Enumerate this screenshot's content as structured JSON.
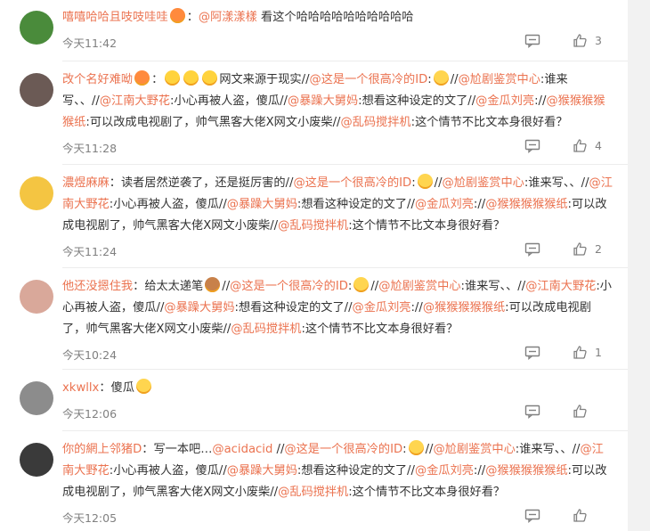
{
  "comments": [
    {
      "name": "嘻嘻哈哈且吱吱哇哇",
      "emoji_after_name": "hot",
      "sep": "：",
      "parts": [
        {
          "t": "mention",
          "v": "@阿漾漾樣"
        },
        {
          "t": "text",
          "v": " 看这个哈哈哈哈哈哈哈哈哈哈"
        }
      ],
      "time": "今天11:42",
      "likes": "3",
      "avatar_color": "#4a8b3b"
    },
    {
      "name": "改个名好难呦",
      "emoji_after_name": "hot",
      "sep": "：",
      "parts": [
        {
          "t": "emoji",
          "v": "laugh"
        },
        {
          "t": "emoji",
          "v": "laugh"
        },
        {
          "t": "emoji",
          "v": "laugh"
        },
        {
          "t": "text",
          "v": "网文来源于现实//"
        },
        {
          "t": "mention",
          "v": "@这是一个很高冷的ID"
        },
        {
          "t": "text",
          "v": ":"
        },
        {
          "t": "emoji",
          "v": "sad"
        },
        {
          "t": "text",
          "v": "//"
        },
        {
          "t": "mention",
          "v": "@尬剧鉴赏中心"
        },
        {
          "t": "text",
          "v": ":谁来写、、//"
        },
        {
          "t": "mention",
          "v": "@江南大野花"
        },
        {
          "t": "text",
          "v": ":小心再被人盗，傻瓜//"
        },
        {
          "t": "mention",
          "v": "@暴躁大舅妈"
        },
        {
          "t": "text",
          "v": ":想看这种设定的文了//"
        },
        {
          "t": "mention",
          "v": "@金瓜刘亮"
        },
        {
          "t": "text",
          "v": "://"
        },
        {
          "t": "mention",
          "v": "@猴猴猴猴猴纸"
        },
        {
          "t": "text",
          "v": ":可以改成电视剧了，帅气黑客大佬X网文小废柴//"
        },
        {
          "t": "mention",
          "v": "@乱码搅拌机"
        },
        {
          "t": "text",
          "v": ":这个情节不比文本身很好看？"
        }
      ],
      "time": "今天11:28",
      "likes": "4",
      "avatar_color": "#6b5a55"
    },
    {
      "name": "濃煜麻麻",
      "emoji_after_name": "",
      "sep": "：",
      "parts": [
        {
          "t": "text",
          "v": "读者居然逆袭了，还是挺厉害的//"
        },
        {
          "t": "mention",
          "v": "@这是一个很高冷的ID"
        },
        {
          "t": "text",
          "v": ":"
        },
        {
          "t": "emoji",
          "v": "sad"
        },
        {
          "t": "text",
          "v": "//"
        },
        {
          "t": "mention",
          "v": "@尬剧鉴赏中心"
        },
        {
          "t": "text",
          "v": ":谁来写、、//"
        },
        {
          "t": "mention",
          "v": "@江南大野花"
        },
        {
          "t": "text",
          "v": ":小心再被人盗，傻瓜//"
        },
        {
          "t": "mention",
          "v": "@暴躁大舅妈"
        },
        {
          "t": "text",
          "v": ":想看这种设定的文了//"
        },
        {
          "t": "mention",
          "v": "@金瓜刘亮"
        },
        {
          "t": "text",
          "v": "://"
        },
        {
          "t": "mention",
          "v": "@猴猴猴猴猴纸"
        },
        {
          "t": "text",
          "v": ":可以改成电视剧了，帅气黑客大佬X网文小废柴//"
        },
        {
          "t": "mention",
          "v": "@乱码搅拌机"
        },
        {
          "t": "text",
          "v": ":这个情节不比文本身很好看？"
        }
      ],
      "time": "今天11:24",
      "likes": "2",
      "avatar_color": "#f4c542"
    },
    {
      "name": "他还没摁住我",
      "emoji_after_name": "",
      "sep": "：",
      "parts": [
        {
          "t": "text",
          "v": "给太太递笔"
        },
        {
          "t": "emoji",
          "v": "brown"
        },
        {
          "t": "text",
          "v": "//"
        },
        {
          "t": "mention",
          "v": "@这是一个很高冷的ID"
        },
        {
          "t": "text",
          "v": ":"
        },
        {
          "t": "emoji",
          "v": "sad"
        },
        {
          "t": "text",
          "v": "//"
        },
        {
          "t": "mention",
          "v": "@尬剧鉴赏中心"
        },
        {
          "t": "text",
          "v": ":谁来写、、//"
        },
        {
          "t": "mention",
          "v": "@江南大野花"
        },
        {
          "t": "text",
          "v": ":小心再被人盗，傻瓜//"
        },
        {
          "t": "mention",
          "v": "@暴躁大舅妈"
        },
        {
          "t": "text",
          "v": ":想看这种设定的文了//"
        },
        {
          "t": "mention",
          "v": "@金瓜刘亮"
        },
        {
          "t": "text",
          "v": "://"
        },
        {
          "t": "mention",
          "v": "@猴猴猴猴猴纸"
        },
        {
          "t": "text",
          "v": ":可以改成电视剧了，帅气黑客大佬X网文小废柴//"
        },
        {
          "t": "mention",
          "v": "@乱码搅拌机"
        },
        {
          "t": "text",
          "v": ":这个情节不比文本身很好看？"
        }
      ],
      "time": "今天10:24",
      "likes": "1",
      "avatar_color": "#d9a89a"
    },
    {
      "name": "xkwllx",
      "emoji_after_name": "",
      "sep": "：",
      "parts": [
        {
          "t": "text",
          "v": "傻瓜"
        },
        {
          "t": "emoji",
          "v": "sad"
        }
      ],
      "time": "今天12:06",
      "likes": "",
      "avatar_color": "#8c8c8c"
    },
    {
      "name": "你的網上邻猪D",
      "emoji_after_name": "",
      "sep": "：",
      "parts": [
        {
          "t": "text",
          "v": "写一本吧…"
        },
        {
          "t": "mention",
          "v": "@acidacid"
        },
        {
          "t": "text",
          "v": " //"
        },
        {
          "t": "mention",
          "v": "@这是一个很高冷的ID"
        },
        {
          "t": "text",
          "v": ":"
        },
        {
          "t": "emoji",
          "v": "sad"
        },
        {
          "t": "text",
          "v": "//"
        },
        {
          "t": "mention",
          "v": "@尬剧鉴赏中心"
        },
        {
          "t": "text",
          "v": ":谁来写、、//"
        },
        {
          "t": "mention",
          "v": "@江南大野花"
        },
        {
          "t": "text",
          "v": ":小心再被人盗，傻瓜//"
        },
        {
          "t": "mention",
          "v": "@暴躁大舅妈"
        },
        {
          "t": "text",
          "v": ":想看这种设定的文了//"
        },
        {
          "t": "mention",
          "v": "@金瓜刘亮"
        },
        {
          "t": "text",
          "v": "://"
        },
        {
          "t": "mention",
          "v": "@猴猴猴猴猴纸"
        },
        {
          "t": "text",
          "v": ":可以改成电视剧了，帅气黑客大佬X网文小废柴//"
        },
        {
          "t": "mention",
          "v": "@乱码搅拌机"
        },
        {
          "t": "text",
          "v": ":这个情节不比文本身很好看？"
        }
      ],
      "time": "今天12:05",
      "likes": "",
      "avatar_color": "#3a3a3a"
    }
  ],
  "colors": {
    "accent": "#eb7350",
    "muted": "#808080"
  },
  "icons": {
    "reply": "comment-icon",
    "like": "thumbs-up-icon"
  }
}
